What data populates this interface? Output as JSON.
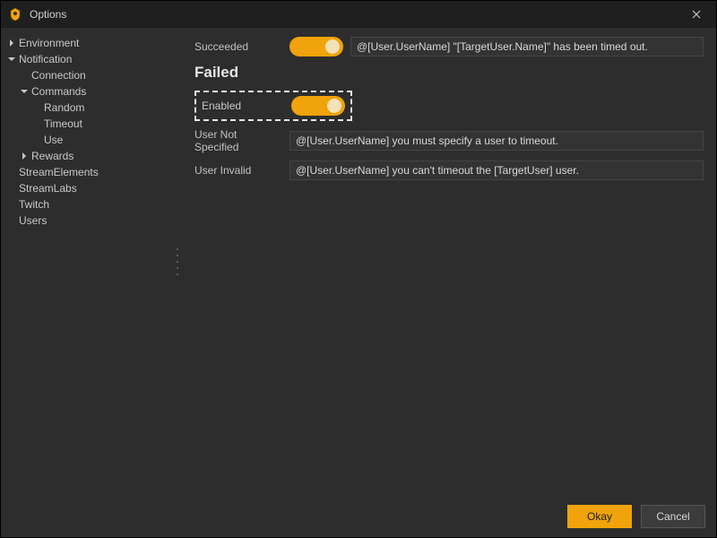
{
  "window": {
    "title": "Options"
  },
  "sidebar": {
    "items": [
      {
        "label": "Environment",
        "expandable": true,
        "expanded": false,
        "depth": 0
      },
      {
        "label": "Notification",
        "expandable": true,
        "expanded": true,
        "depth": 0
      },
      {
        "label": "Connection",
        "expandable": false,
        "depth": 1
      },
      {
        "label": "Commands",
        "expandable": true,
        "expanded": true,
        "depth": 1
      },
      {
        "label": "Random",
        "expandable": false,
        "depth": 2
      },
      {
        "label": "Timeout",
        "expandable": false,
        "depth": 2
      },
      {
        "label": "Use",
        "expandable": false,
        "depth": 2
      },
      {
        "label": "Rewards",
        "expandable": true,
        "expanded": false,
        "depth": 1
      },
      {
        "label": "StreamElements",
        "expandable": false,
        "depth": 0
      },
      {
        "label": "StreamLabs",
        "expandable": false,
        "depth": 0
      },
      {
        "label": "Twitch",
        "expandable": false,
        "depth": 0
      },
      {
        "label": "Users",
        "expandable": false,
        "depth": 0
      }
    ]
  },
  "content": {
    "succeeded": {
      "label": "Succeeded",
      "toggle_on": true,
      "value": "@[User.UserName] \"[TargetUser.Name]\" has been timed out."
    },
    "failed_heading": "Failed",
    "enabled": {
      "label": "Enabled",
      "toggle_on": true
    },
    "user_not_specified": {
      "label": "User Not Specified",
      "value": "@[User.UserName] you must specify a user to timeout."
    },
    "user_invalid": {
      "label": "User Invalid",
      "value": "@[User.UserName] you can't timeout the [TargetUser] user."
    }
  },
  "footer": {
    "okay": "Okay",
    "cancel": "Cancel"
  },
  "colors": {
    "accent": "#f0a30a",
    "bg": "#2d2d2d",
    "input_bg": "#333333"
  }
}
